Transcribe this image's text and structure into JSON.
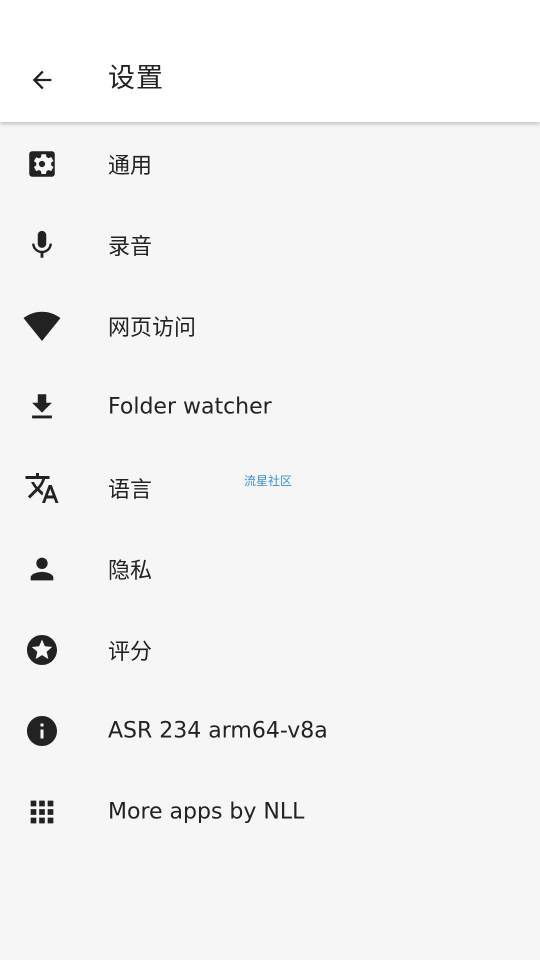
{
  "header": {
    "title": "设置",
    "back_icon": "arrow-left-icon"
  },
  "menu": {
    "items": [
      {
        "label": "通用",
        "icon": "settings-gear-icon"
      },
      {
        "label": "录音",
        "icon": "microphone-icon"
      },
      {
        "label": "网页访问",
        "icon": "wifi-icon"
      },
      {
        "label": "Folder watcher",
        "icon": "download-icon"
      },
      {
        "label": "语言",
        "icon": "translate-icon"
      },
      {
        "label": "隐私",
        "icon": "person-icon"
      },
      {
        "label": "评分",
        "icon": "star-circle-icon"
      },
      {
        "label": "ASR 234 arm64-v8a",
        "icon": "info-icon"
      },
      {
        "label": "More apps by NLL",
        "icon": "apps-grid-icon"
      }
    ]
  },
  "watermark": "流星社区",
  "colors": {
    "app_bar": "#ffffff",
    "background": "#f6f6f6",
    "text": "#222222",
    "watermark": "#3d8fd6"
  }
}
